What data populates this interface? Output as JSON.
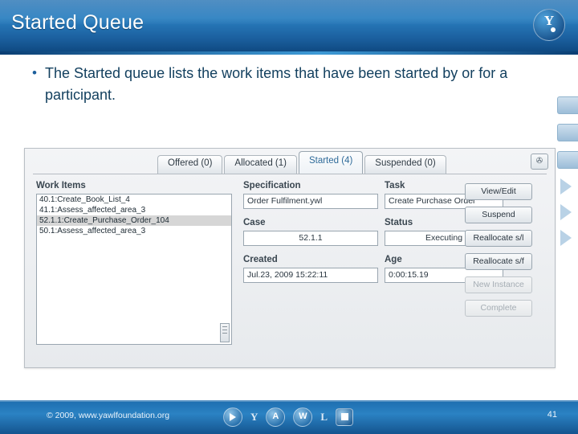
{
  "slide": {
    "title": "Started Queue",
    "bullet": "The Started queue lists the work items that have been started by or for a participant.",
    "bullet_marker": "•",
    "logo_letter": "Y",
    "page_number": "41",
    "copyright": "© 2009, www.yawlfoundation.org"
  },
  "app": {
    "corner_icon": "✇",
    "tabs": [
      {
        "label": "Offered (0)",
        "active": false
      },
      {
        "label": "Allocated (1)",
        "active": false
      },
      {
        "label": "Started (4)",
        "active": true
      },
      {
        "label": "Suspended (0)",
        "active": false
      }
    ],
    "work_items": {
      "label": "Work Items",
      "rows": [
        {
          "text": "40.1:Create_Book_List_4",
          "selected": false
        },
        {
          "text": "41.1:Assess_affected_area_3",
          "selected": false
        },
        {
          "text": "52.1.1:Create_Purchase_Order_104",
          "selected": true
        },
        {
          "text": "50.1:Assess_affected_area_3",
          "selected": false
        }
      ]
    },
    "fields": [
      {
        "label": "Specification",
        "value": "Order Fulfilment.ywl"
      },
      {
        "label": "Task",
        "value": "Create Purchase Order"
      },
      {
        "label": "Case",
        "value": "52.1.1"
      },
      {
        "label": "Status",
        "value": "Executing"
      },
      {
        "label": "Created",
        "value": "Jul.23, 2009 15:22:11"
      },
      {
        "label": "Age",
        "value": "0:00:15.19"
      }
    ],
    "buttons": [
      {
        "label": "View/Edit",
        "enabled": true
      },
      {
        "label": "Suspend",
        "enabled": true
      },
      {
        "label": "Reallocate s/l",
        "enabled": true
      },
      {
        "label": "Reallocate s/f",
        "enabled": true
      },
      {
        "label": "New Instance",
        "enabled": false
      },
      {
        "label": "Complete",
        "enabled": false
      }
    ]
  },
  "footer_icons": {
    "play": "play-icon",
    "y": "Y",
    "a": "A",
    "w": "W",
    "l": "L"
  },
  "colors": {
    "header_blue": "#1f6fb2",
    "title_text": "#ffffff",
    "body_text": "#13405f",
    "active_tab_text": "#2f6b9a"
  }
}
